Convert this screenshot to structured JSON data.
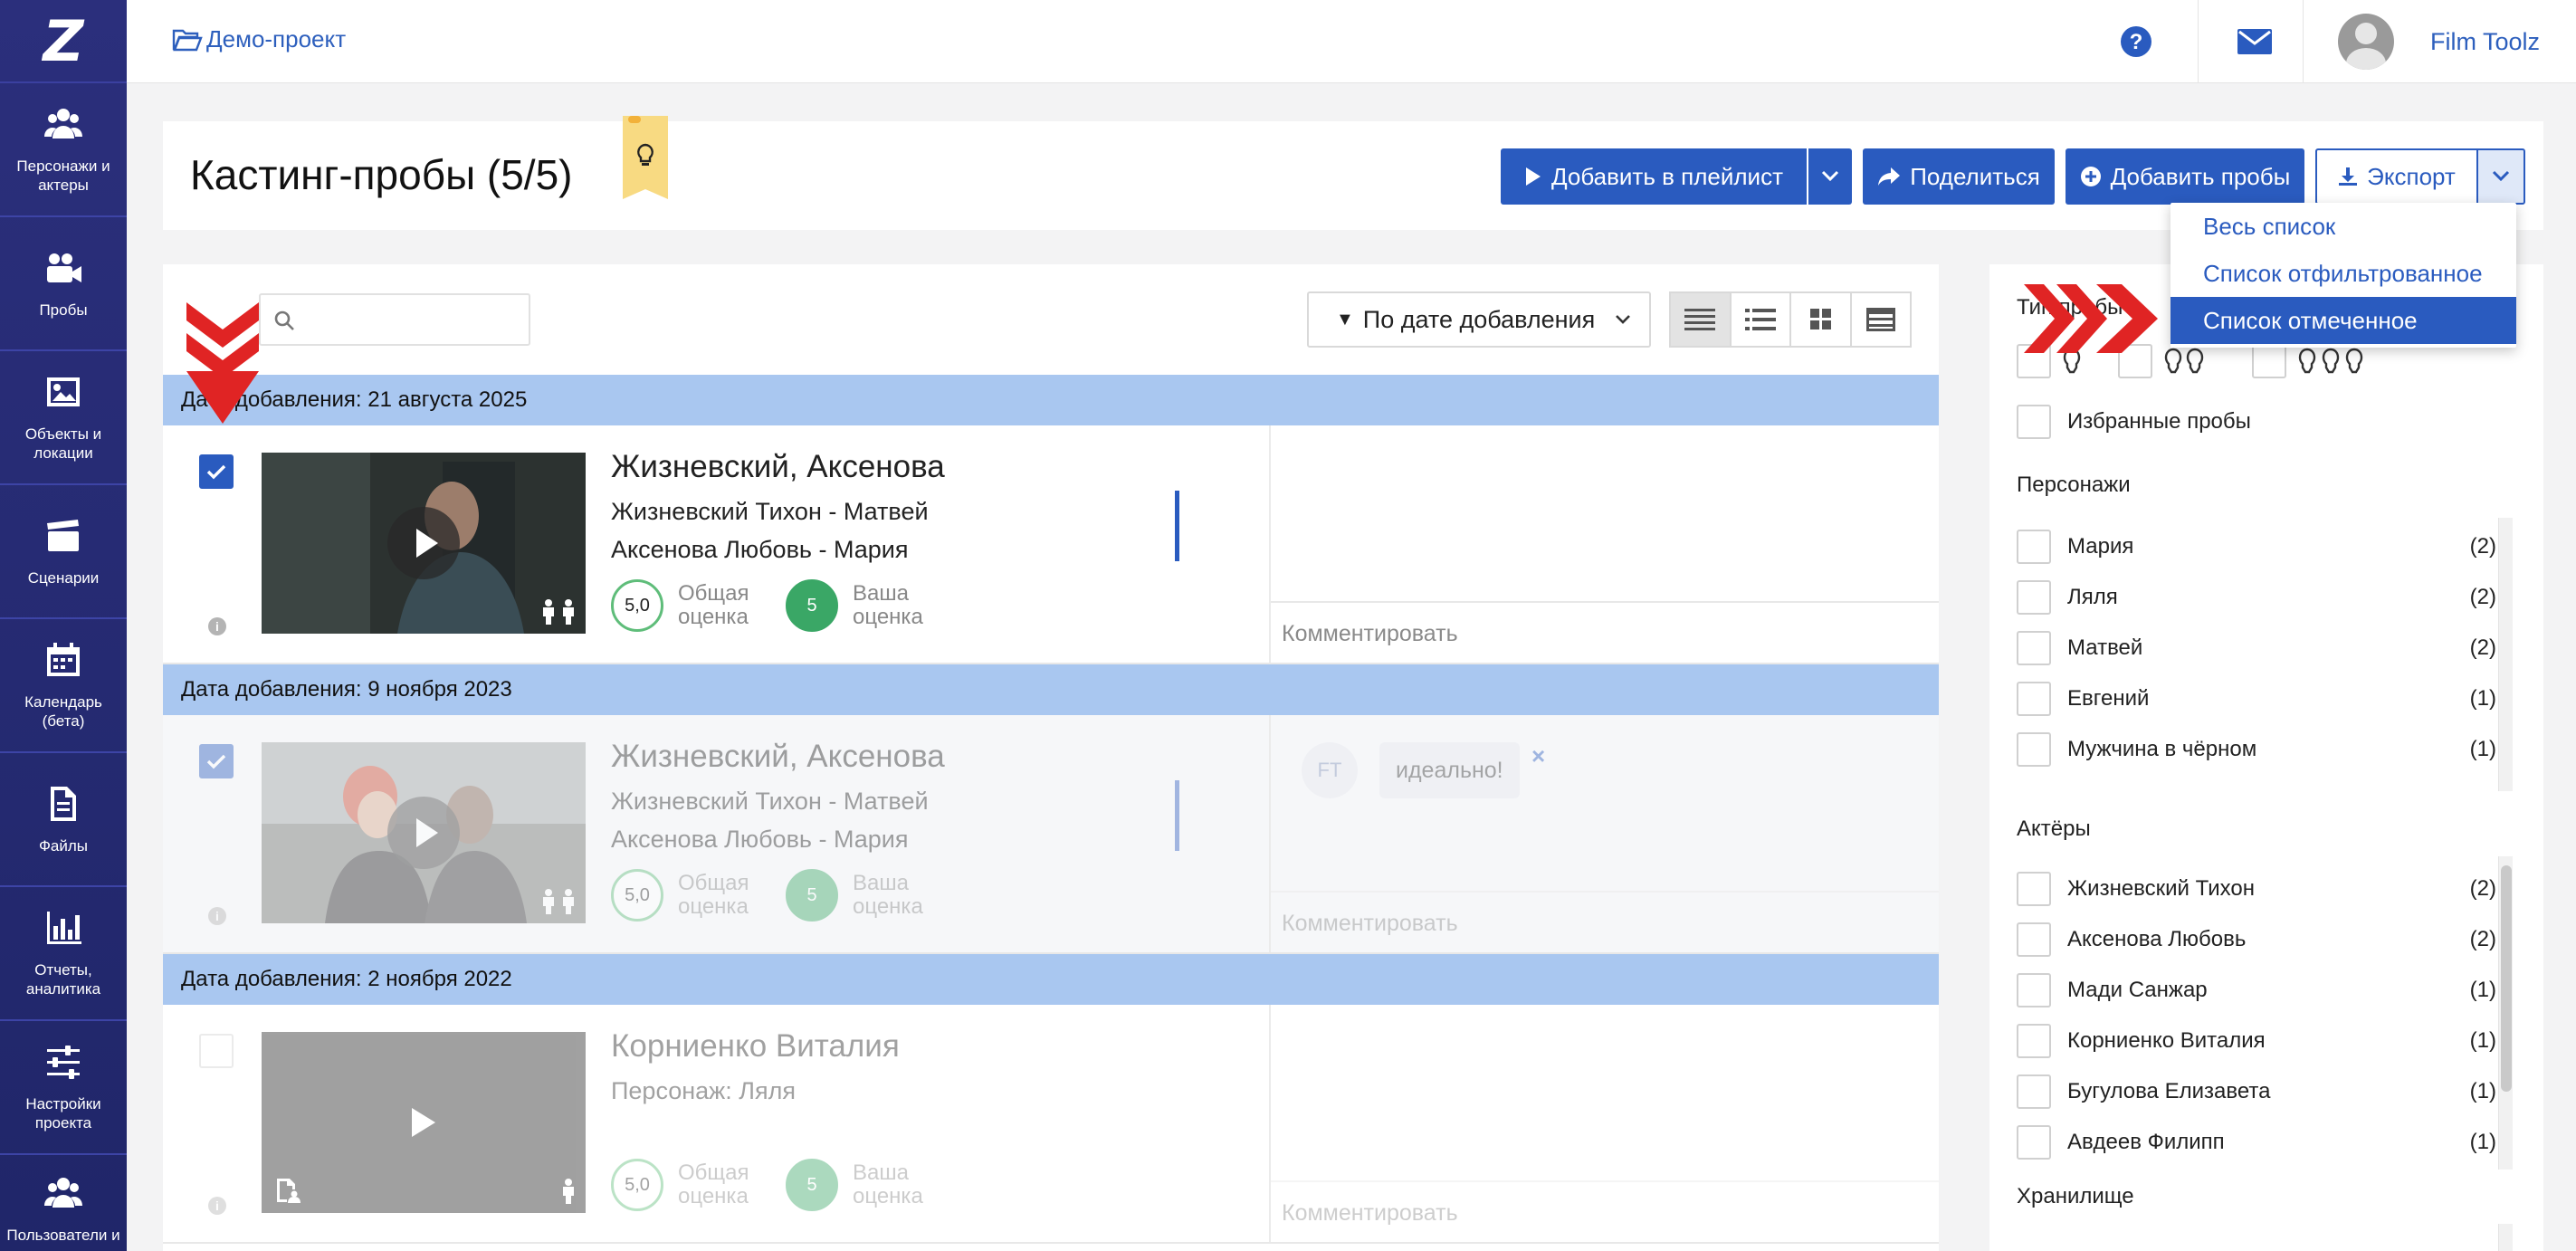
{
  "app": {
    "logo": "Z"
  },
  "sidebar": {
    "items": [
      {
        "label": "Персонажи и актеры",
        "icon": "users-icon"
      },
      {
        "label": "Пробы",
        "icon": "video-camera-icon"
      },
      {
        "label": "Объекты и локации",
        "icon": "image-icon"
      },
      {
        "label": "Сценарии",
        "icon": "clapperboard-icon"
      },
      {
        "label": "Календарь (бета)",
        "icon": "calendar-icon"
      },
      {
        "label": "Файлы",
        "icon": "file-icon"
      },
      {
        "label": "Отчеты, аналитика",
        "icon": "bar-chart-icon"
      },
      {
        "label": "Настройки проекта",
        "icon": "sliders-icon"
      },
      {
        "label": "Пользователи и",
        "icon": "users-icon"
      }
    ]
  },
  "topbar": {
    "breadcrumb": "Демо-проект",
    "user_name": "Film Toolz"
  },
  "header": {
    "title": "Кастинг-пробы (5/5)",
    "add_to_playlist": "Добавить в плейлист",
    "share": "Поделиться",
    "add_tests": "Добавить пробы",
    "export": "Экспорт"
  },
  "export_menu": {
    "options": [
      "Весь список",
      "Список отфильтрованное",
      "Список отмеченное"
    ],
    "selected_index": 2
  },
  "list": {
    "search_placeholder": "",
    "sort_label": "По дате добавления",
    "groups": [
      {
        "header": "Дата добавления: 21 августа 2025",
        "row": {
          "checked": true,
          "title": "Жизневский, Аксенова",
          "line1": "Жизневский Тихон - Матвей",
          "line2": "Аксенова Любовь - Мария",
          "overall_score": "5,0",
          "overall_label_1": "Общая",
          "overall_label_2": "оценка",
          "my_score": "5",
          "my_label_1": "Ваша",
          "my_label_2": "оценка",
          "comment_placeholder": "Комментировать"
        }
      },
      {
        "header": "Дата добавления: 9 ноября 2023",
        "row": {
          "checked": true,
          "title": "Жизневский, Аксенова",
          "line1": "Жизневский Тихон - Матвей",
          "line2": "Аксенова Любовь - Мария",
          "overall_score": "5,0",
          "overall_label_1": "Общая",
          "overall_label_2": "оценка",
          "my_score": "5",
          "my_label_1": "Ваша",
          "my_label_2": "оценка",
          "comment_author": "FT",
          "comment_text": "идеально!",
          "comment_delete": "×",
          "comment_placeholder": "Комментировать"
        }
      },
      {
        "header": "Дата добавления: 2 ноября 2022",
        "row": {
          "checked": false,
          "title": "Корниенко Виталия",
          "line1": "Персонаж: Ляля",
          "overall_score": "5,0",
          "overall_label_1": "Общая",
          "overall_label_2": "оценка",
          "my_score": "5",
          "my_label_1": "Ваша",
          "my_label_2": "оценка",
          "comment_placeholder": "Комментировать"
        }
      }
    ]
  },
  "filters": {
    "type_label": "Тип пробы",
    "favorites": "Избранные пробы",
    "characters_label": "Персонажи",
    "characters": [
      {
        "name": "Мария",
        "count": "(2)"
      },
      {
        "name": "Ляля",
        "count": "(2)"
      },
      {
        "name": "Матвей",
        "count": "(2)"
      },
      {
        "name": "Евгений",
        "count": "(1)"
      },
      {
        "name": "Мужчина в чёрном",
        "count": "(1)"
      }
    ],
    "actors_label": "Актёры",
    "actors": [
      {
        "name": "Жизневский Тихон",
        "count": "(2)"
      },
      {
        "name": "Аксенова Любовь",
        "count": "(2)"
      },
      {
        "name": "Мади Санжар",
        "count": "(1)"
      },
      {
        "name": "Корниенко Виталия",
        "count": "(1)"
      },
      {
        "name": "Бугулова Елизавета",
        "count": "(1)"
      },
      {
        "name": "Авдеев Филипп",
        "count": "(1)"
      }
    ],
    "storage_label": "Хранилище"
  },
  "colors": {
    "sidebar": "#232a72",
    "primary": "#2a5bbf",
    "group_header": "#a9c7f0",
    "score_green": "#3aa766",
    "annotation_red": "#e02424"
  }
}
